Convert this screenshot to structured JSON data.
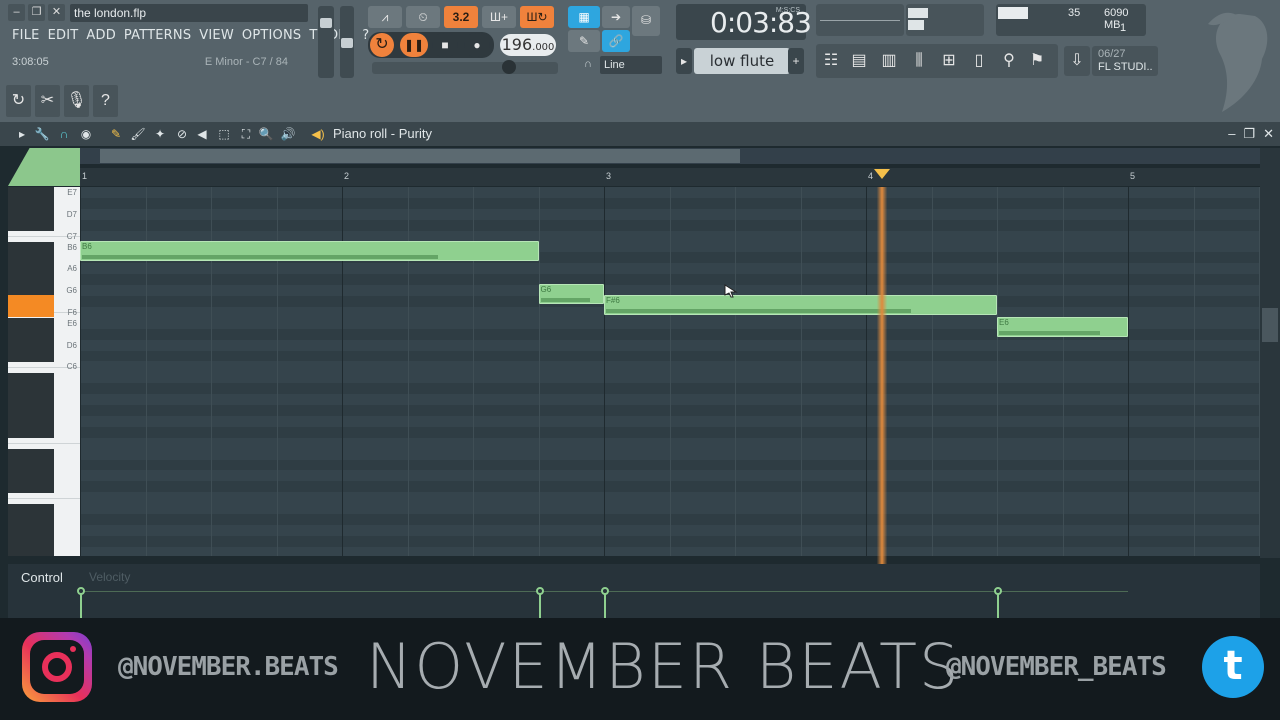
{
  "app": {
    "file_name": "the london.flp",
    "menu": [
      "FILE",
      "EDIT",
      "ADD",
      "PATTERNS",
      "VIEW",
      "OPTIONS",
      "TOOLS",
      "?"
    ],
    "hint_time": "3:08:05",
    "hint_key": "E Minor - C7 / 84"
  },
  "transport": {
    "pattern_song_label": "3.2",
    "tempo": "196",
    "tempo_decimal": ".000",
    "time_display": "0:03:83",
    "time_format": "M:S:CS",
    "snap": "Line",
    "instrument": "low flute"
  },
  "meters": {
    "cpu": "35",
    "memory": "6090 MB",
    "polyphony": "1"
  },
  "news": {
    "date": "06/27",
    "title": "FL STUDI.."
  },
  "piano_roll": {
    "title": "Piano roll - Purity",
    "ruler_bars": [
      "1",
      "2",
      "3",
      "4",
      "5"
    ],
    "keys": [
      "E7",
      "D7",
      "C7",
      "B6",
      "A6",
      "G6",
      "F6",
      "E6",
      "D6",
      "C6"
    ],
    "notes": [
      {
        "pitch": "B6",
        "start_bar": 1.0,
        "end_bar": 2.75,
        "velocity": 0.78
      },
      {
        "pitch": "G6",
        "start_bar": 2.75,
        "end_bar": 3.0,
        "velocity": 0.78
      },
      {
        "pitch": "F#6",
        "start_bar": 3.0,
        "end_bar": 4.5,
        "velocity": 0.78
      },
      {
        "pitch": "E6",
        "start_bar": 4.5,
        "end_bar": 5.0,
        "velocity": 0.78
      }
    ],
    "playhead_bar": 4.06,
    "control_label": "Control",
    "control_param": "Velocity"
  },
  "branding": {
    "instagram": "@NOVEMBER.BEATS",
    "name": "NOVEMBER BEATS",
    "twitter": "@NOVEMBER_BEATS"
  },
  "colors": {
    "note": "#8fd08f",
    "playhead": "#e08a3c",
    "accent_orange": "#f0823c",
    "accent_blue": "#2ea6df"
  }
}
